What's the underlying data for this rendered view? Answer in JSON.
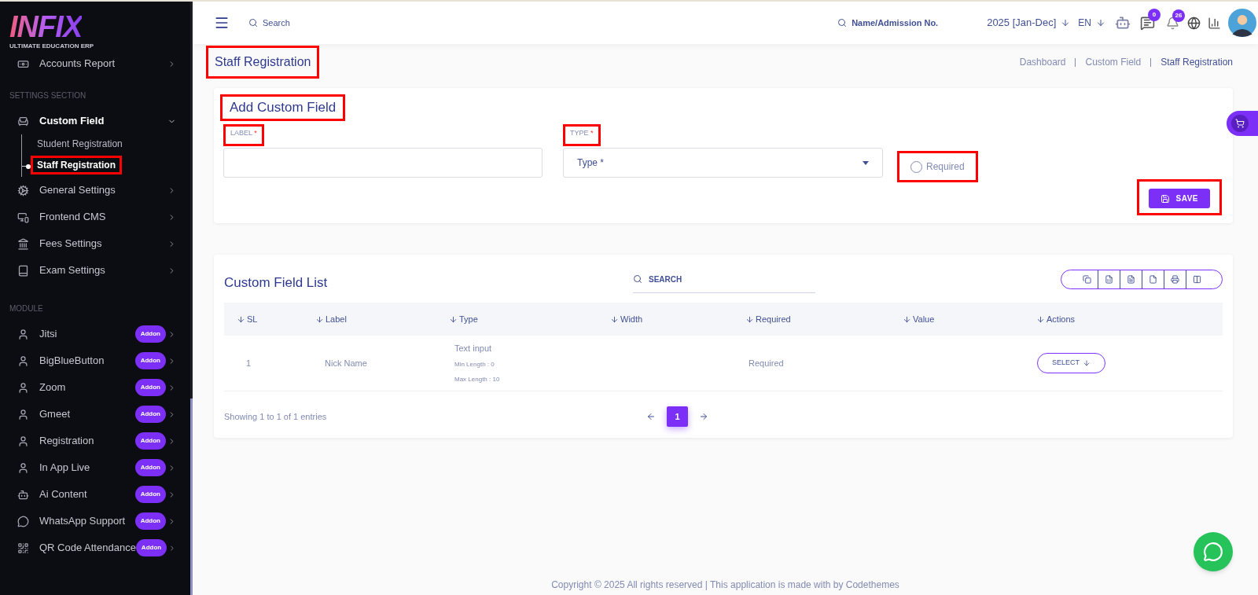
{
  "sidebar": {
    "logo": {
      "wordmark": "INFIX",
      "tagline": "ULTIMATE EDUCATION ERP"
    },
    "sections": [
      {
        "items": [
          {
            "label": "Accounts Report",
            "expanded": false
          }
        ]
      },
      {
        "title": "SETTINGS SECTION",
        "items": [
          {
            "label": "Custom Field",
            "expanded": true,
            "children": [
              {
                "label": "Student Registration",
                "selected": false,
                "highlighted": false
              },
              {
                "label": "Staff Registration",
                "selected": true,
                "highlighted": true
              }
            ]
          },
          {
            "label": "General Settings",
            "expanded": false
          },
          {
            "label": "Frontend CMS",
            "expanded": false
          },
          {
            "label": "Fees Settings",
            "expanded": false
          },
          {
            "label": "Exam Settings",
            "expanded": false
          }
        ]
      },
      {
        "title": "MODULE",
        "items": [
          {
            "label": "Jitsi",
            "badge": "Addon",
            "expanded": false
          },
          {
            "label": "BigBlueButton",
            "badge": "Addon",
            "expanded": false
          },
          {
            "label": "Zoom",
            "badge": "Addon",
            "expanded": false
          },
          {
            "label": "Gmeet",
            "badge": "Addon",
            "expanded": false
          },
          {
            "label": "Registration",
            "badge": "Addon",
            "expanded": false
          },
          {
            "label": "In App Live",
            "badge": "Addon",
            "expanded": false
          },
          {
            "label": "Ai Content",
            "badge": "Addon",
            "expanded": false
          },
          {
            "label": "WhatsApp Support",
            "badge": "Addon",
            "expanded": false
          },
          {
            "label": "QR Code Attendance",
            "badge": "Addon",
            "expanded": false
          }
        ]
      }
    ]
  },
  "topbar": {
    "search": {
      "placeholder": "Search"
    },
    "student_search": {
      "placeholder": "Name/Admission No."
    },
    "session": "2025 [Jan-Dec]",
    "language": "EN",
    "messages_count": "0",
    "notifications_count": "26"
  },
  "page_title": {
    "text": "Staff Registration",
    "highlighted": true
  },
  "breadcrumb": [
    {
      "label": "Dashboard",
      "current": false
    },
    {
      "label": "Custom Field",
      "current": false
    },
    {
      "label": "Staff Registration",
      "current": true
    }
  ],
  "form": {
    "title": {
      "text": "Add Custom Field",
      "highlighted": true
    },
    "label_field": {
      "label": "LABEL",
      "required_mark": "*",
      "highlighted": true
    },
    "type_field": {
      "label": "TYPE",
      "required_mark": "*",
      "placeholder": "Type *",
      "highlighted": true
    },
    "required_option": {
      "label": "Required",
      "checked": false,
      "highlighted": true
    },
    "save_button": {
      "label": "SAVE",
      "highlighted": true
    }
  },
  "list": {
    "title": "Custom Field List",
    "search": {
      "placeholder": "SEARCH"
    },
    "columns": [
      "SL",
      "Label",
      "Type",
      "Width",
      "Required",
      "Value",
      "Actions"
    ],
    "rows": [
      {
        "sl": "1",
        "label": "Nick Name",
        "type": "Text input",
        "type_details": [
          "Min Length : 0",
          "Max Length : 10"
        ],
        "required": "Required",
        "action": "SELECT"
      }
    ],
    "summary": "Showing 1 to 1 of 1 entries",
    "pages": [
      {
        "label": "1",
        "selected": true
      }
    ]
  },
  "footer": "Copyright © 2025 All rights reserved | This application is made with by Codethemes"
}
